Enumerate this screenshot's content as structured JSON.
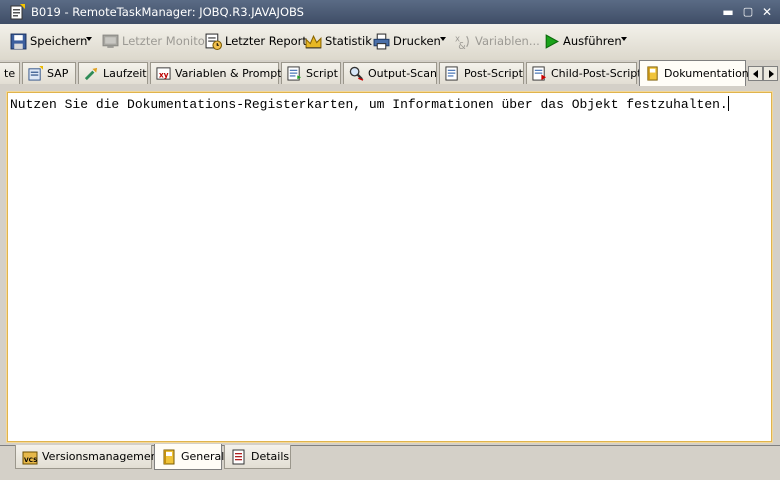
{
  "window": {
    "title": "B019 - RemoteTaskManager: JOBQ.R3.JAVAJOBS"
  },
  "toolbar": {
    "save": "Speichern",
    "last_monitor": "Letzter Monitor",
    "last_report": "Letzter Report",
    "statistics": "Statistik",
    "print": "Drucken",
    "variables": "Variablen...",
    "execute": "Ausführen"
  },
  "tabs": [
    "te",
    "SAP",
    "Laufzeit",
    "Variablen & Prompts",
    "Script",
    "Output-Scan",
    "Post-Script",
    "Child-Post-Script",
    "Dokumentation"
  ],
  "active_tab": "Dokumentation",
  "editor": {
    "text": "Nutzen Sie die Dokumentations-Registerkarten, um Informationen über das Objekt festzuhalten."
  },
  "bottom_tabs": [
    "Versionsmanagement",
    "General",
    "Details"
  ],
  "active_bottom_tab": "General",
  "colors": {
    "title_bar": "#4a5a74",
    "editor_border": "#e0b44c",
    "play_green": "#1aa31a"
  }
}
